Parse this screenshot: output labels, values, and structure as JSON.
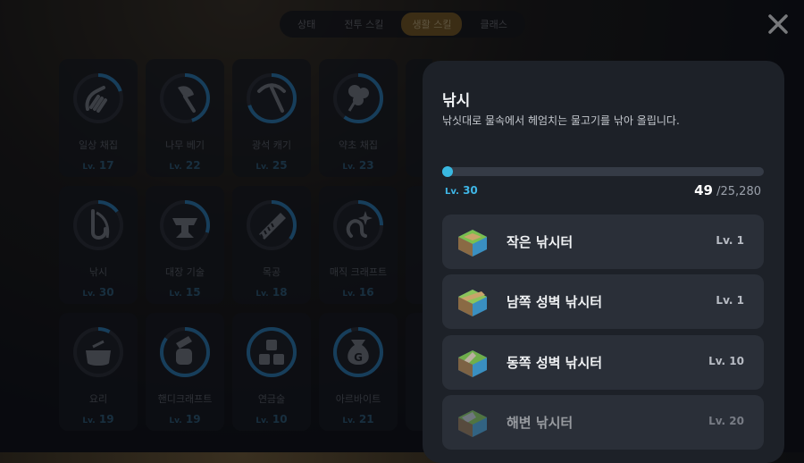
{
  "tabs": [
    {
      "label": "상태",
      "active": false
    },
    {
      "label": "전투 스킬",
      "active": false
    },
    {
      "label": "생활 스킬",
      "active": true
    },
    {
      "label": "클래스",
      "active": false
    }
  ],
  "skills": [
    {
      "name": "일상 채집",
      "level": "17",
      "icon": "hand-gather-icon"
    },
    {
      "name": "나무 베기",
      "level": "22",
      "icon": "axe-icon"
    },
    {
      "name": "광석 캐기",
      "level": "25",
      "icon": "pickaxe-icon"
    },
    {
      "name": "약초 채집",
      "level": "23",
      "icon": "herb-icon"
    },
    {
      "name": "낚시",
      "level": "30",
      "icon": "fishing-hook-icon"
    },
    {
      "name": "대장 기술",
      "level": "15",
      "icon": "anvil-icon"
    },
    {
      "name": "목공",
      "level": "18",
      "icon": "saw-icon"
    },
    {
      "name": "매직 크래프트",
      "level": "16",
      "icon": "magic-craft-icon"
    },
    {
      "name": "요리",
      "level": "19",
      "icon": "pot-icon"
    },
    {
      "name": "핸디크래프트",
      "level": "19",
      "icon": "hammer-fist-icon"
    },
    {
      "name": "연금술",
      "level": "10",
      "icon": "alchemy-icon"
    },
    {
      "name": "아르바이트",
      "level": "21",
      "icon": "money-bag-icon"
    }
  ],
  "lv_prefix": "Lv.",
  "detail": {
    "title": "낚시",
    "description": "낚싯대로 물속에서 헤엄치는 물고기를 낚아 올립니다.",
    "level_prefix": "Lv.",
    "level": "30",
    "exp_current": "49",
    "exp_total": "/25,280",
    "exp_progress": 0.002,
    "spots": [
      {
        "name": "작은 낚시터",
        "level": "Lv. 1"
      },
      {
        "name": "남쪽 성벽 낚시터",
        "level": "Lv. 1"
      },
      {
        "name": "동쪽 성벽 낚시터",
        "level": "Lv. 10"
      },
      {
        "name": "해변 낚시터",
        "level": "Lv. 20"
      }
    ]
  },
  "colors": {
    "accent": "#39b8e0",
    "ring": "#2a7fb8",
    "panel": "#1d2128",
    "tab_active": "#7a5a1e"
  }
}
